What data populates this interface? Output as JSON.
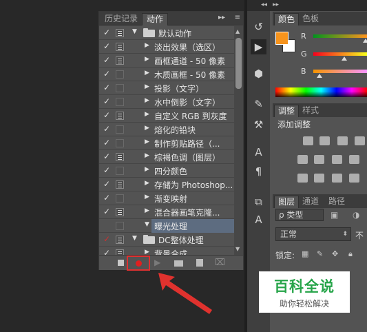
{
  "actions_panel": {
    "tabs": [
      {
        "label": "历史记录",
        "active": false
      },
      {
        "label": "动作",
        "active": true
      }
    ],
    "forward_icon": "▸▸",
    "menu_icon": "≡",
    "rows": [
      {
        "check": "✓",
        "check_color": "white",
        "toggle": "on",
        "level": 0,
        "expanded": true,
        "folder": true,
        "label": "默认动作"
      },
      {
        "check": "✓",
        "check_color": "white",
        "toggle": "on",
        "level": 1,
        "expanded": false,
        "folder": false,
        "label": "淡出效果（选区）"
      },
      {
        "check": "✓",
        "check_color": "white",
        "toggle": "on",
        "level": 1,
        "expanded": false,
        "folder": false,
        "label": "画框通道 - 50 像素"
      },
      {
        "check": "✓",
        "check_color": "white",
        "toggle": "off",
        "level": 1,
        "expanded": false,
        "folder": false,
        "label": "木质画框 - 50 像素"
      },
      {
        "check": "✓",
        "check_color": "white",
        "toggle": "off",
        "level": 1,
        "expanded": false,
        "folder": false,
        "label": "投影（文字）"
      },
      {
        "check": "✓",
        "check_color": "white",
        "toggle": "off",
        "level": 1,
        "expanded": false,
        "folder": false,
        "label": "水中倒影（文字）"
      },
      {
        "check": "✓",
        "check_color": "white",
        "toggle": "on",
        "level": 1,
        "expanded": false,
        "folder": false,
        "label": "自定义 RGB 到灰度"
      },
      {
        "check": "✓",
        "check_color": "white",
        "toggle": "off",
        "level": 1,
        "expanded": false,
        "folder": false,
        "label": "熔化的铅块"
      },
      {
        "check": "✓",
        "check_color": "white",
        "toggle": "off",
        "level": 1,
        "expanded": false,
        "folder": false,
        "label": "制作剪贴路径（..."
      },
      {
        "check": "✓",
        "check_color": "white",
        "toggle": "on",
        "level": 1,
        "expanded": false,
        "folder": false,
        "label": "棕褐色调（图层）"
      },
      {
        "check": "✓",
        "check_color": "white",
        "toggle": "off",
        "level": 1,
        "expanded": false,
        "folder": false,
        "label": "四分颜色"
      },
      {
        "check": "✓",
        "check_color": "white",
        "toggle": "on",
        "level": 1,
        "expanded": false,
        "folder": false,
        "label": "存储为 Photoshop..."
      },
      {
        "check": "✓",
        "check_color": "white",
        "toggle": "off",
        "level": 1,
        "expanded": false,
        "folder": false,
        "label": "渐变映射"
      },
      {
        "check": "✓",
        "check_color": "white",
        "toggle": "on",
        "level": 1,
        "expanded": false,
        "folder": false,
        "label": "混合器画笔克隆..."
      },
      {
        "check": "",
        "check_color": "white",
        "toggle": "off",
        "level": 1,
        "expanded": true,
        "folder": false,
        "selected": true,
        "label": "曝光处理"
      },
      {
        "check": "✓",
        "check_color": "red",
        "toggle": "on",
        "level": 0,
        "expanded": true,
        "folder": true,
        "label": "DC整体处理"
      },
      {
        "check": "✓",
        "check_color": "white",
        "toggle": "on",
        "level": 1,
        "expanded": false,
        "folder": false,
        "label": "背景合成"
      }
    ],
    "toolbar": {
      "stop_label": "停止",
      "record_label": "开始记录",
      "play_icon": "▶",
      "delete_icon": "🗑"
    }
  },
  "tools": {
    "collapse_icon": "◂◂",
    "items": [
      {
        "name": "history-brush-icon",
        "glyph": "↺"
      },
      {
        "name": "play-action-icon",
        "glyph": "▶",
        "active": true
      },
      {
        "name": "3d-cube-icon",
        "glyph": "⬢"
      },
      {
        "name": "brush-presets-icon",
        "glyph": "✎"
      },
      {
        "name": "tool-presets-icon",
        "glyph": "⚒"
      },
      {
        "name": "character-icon",
        "glyph": "A"
      },
      {
        "name": "paragraph-icon",
        "glyph": "¶"
      },
      {
        "name": "clone-source-icon",
        "glyph": "⧉"
      },
      {
        "name": "glyph-style-icon",
        "glyph": "A"
      }
    ]
  },
  "color_panel": {
    "tabs": [
      {
        "label": "颜色",
        "active": true
      },
      {
        "label": "色板",
        "active": false
      }
    ],
    "foreground_color": "#f7941d",
    "background_color": "#ffffff",
    "channels": [
      {
        "label": "R",
        "value": 247
      },
      {
        "label": "G",
        "value": 148
      },
      {
        "label": "B",
        "value": 29
      }
    ]
  },
  "adjustments_panel": {
    "tabs": [
      {
        "label": "调整",
        "active": true
      },
      {
        "label": "样式",
        "active": false
      }
    ],
    "add_label": "添加调整"
  },
  "layers_panel": {
    "tabs": [
      {
        "label": "图层",
        "active": true
      },
      {
        "label": "通道",
        "active": false
      },
      {
        "label": "路径",
        "active": false
      }
    ],
    "kind_label": "ρ 类型",
    "blend_mode": "正常",
    "opacity_label": "不",
    "lock_label": "锁定:"
  },
  "watermark": {
    "title": "百科全说",
    "subtitle": "助你轻松解决"
  }
}
